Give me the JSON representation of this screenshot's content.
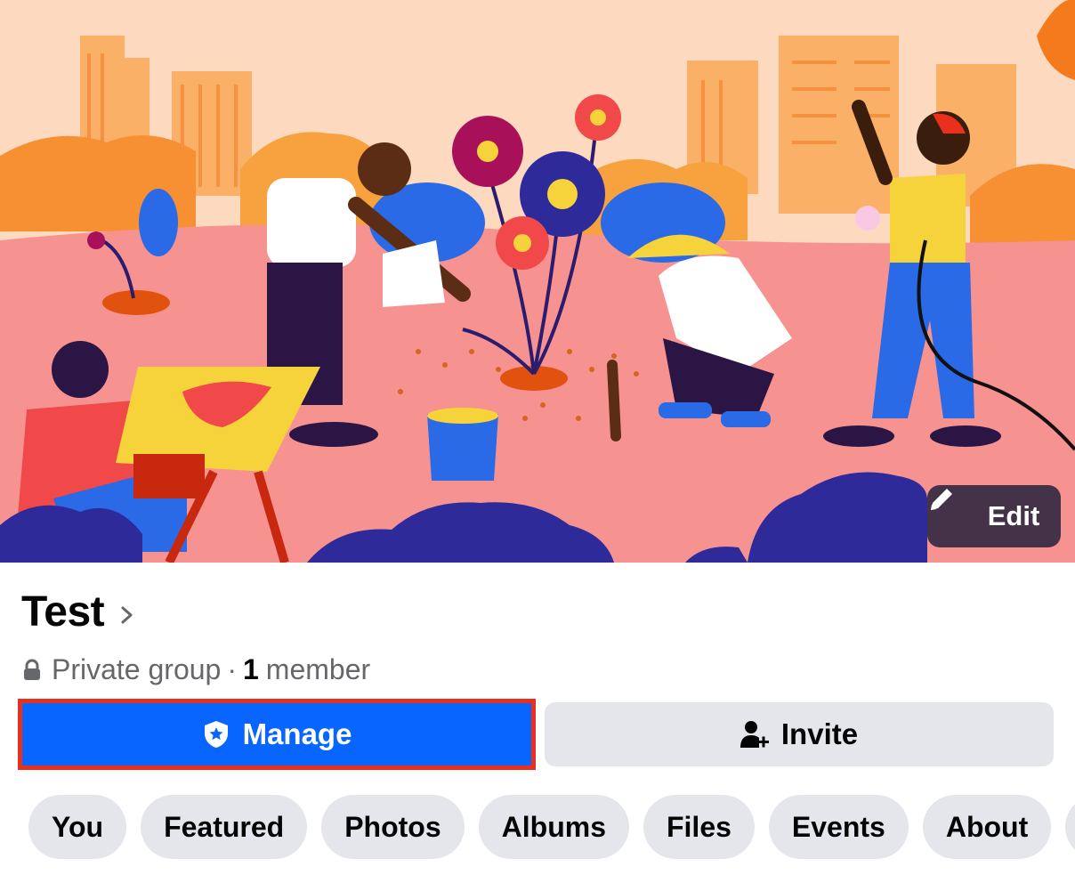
{
  "cover": {
    "edit_label": "Edit"
  },
  "group": {
    "name": "Test",
    "privacy": "Private group",
    "separator": "·",
    "member_count": "1",
    "member_label": "member"
  },
  "actions": {
    "manage_label": "Manage",
    "invite_label": "Invite"
  },
  "tabs": [
    {
      "label": "You"
    },
    {
      "label": "Featured"
    },
    {
      "label": "Photos"
    },
    {
      "label": "Albums"
    },
    {
      "label": "Files"
    },
    {
      "label": "Events"
    },
    {
      "label": "About"
    }
  ],
  "colors": {
    "primary": "#0866ff",
    "highlight": "#e8301c",
    "secondary_button": "#e4e6eb",
    "muted_text": "#65676b"
  },
  "icons": {
    "edit": "pencil-icon",
    "chevron": "chevron-right-icon",
    "privacy": "lock-icon",
    "manage": "shield-star-icon",
    "invite": "person-add-icon"
  }
}
